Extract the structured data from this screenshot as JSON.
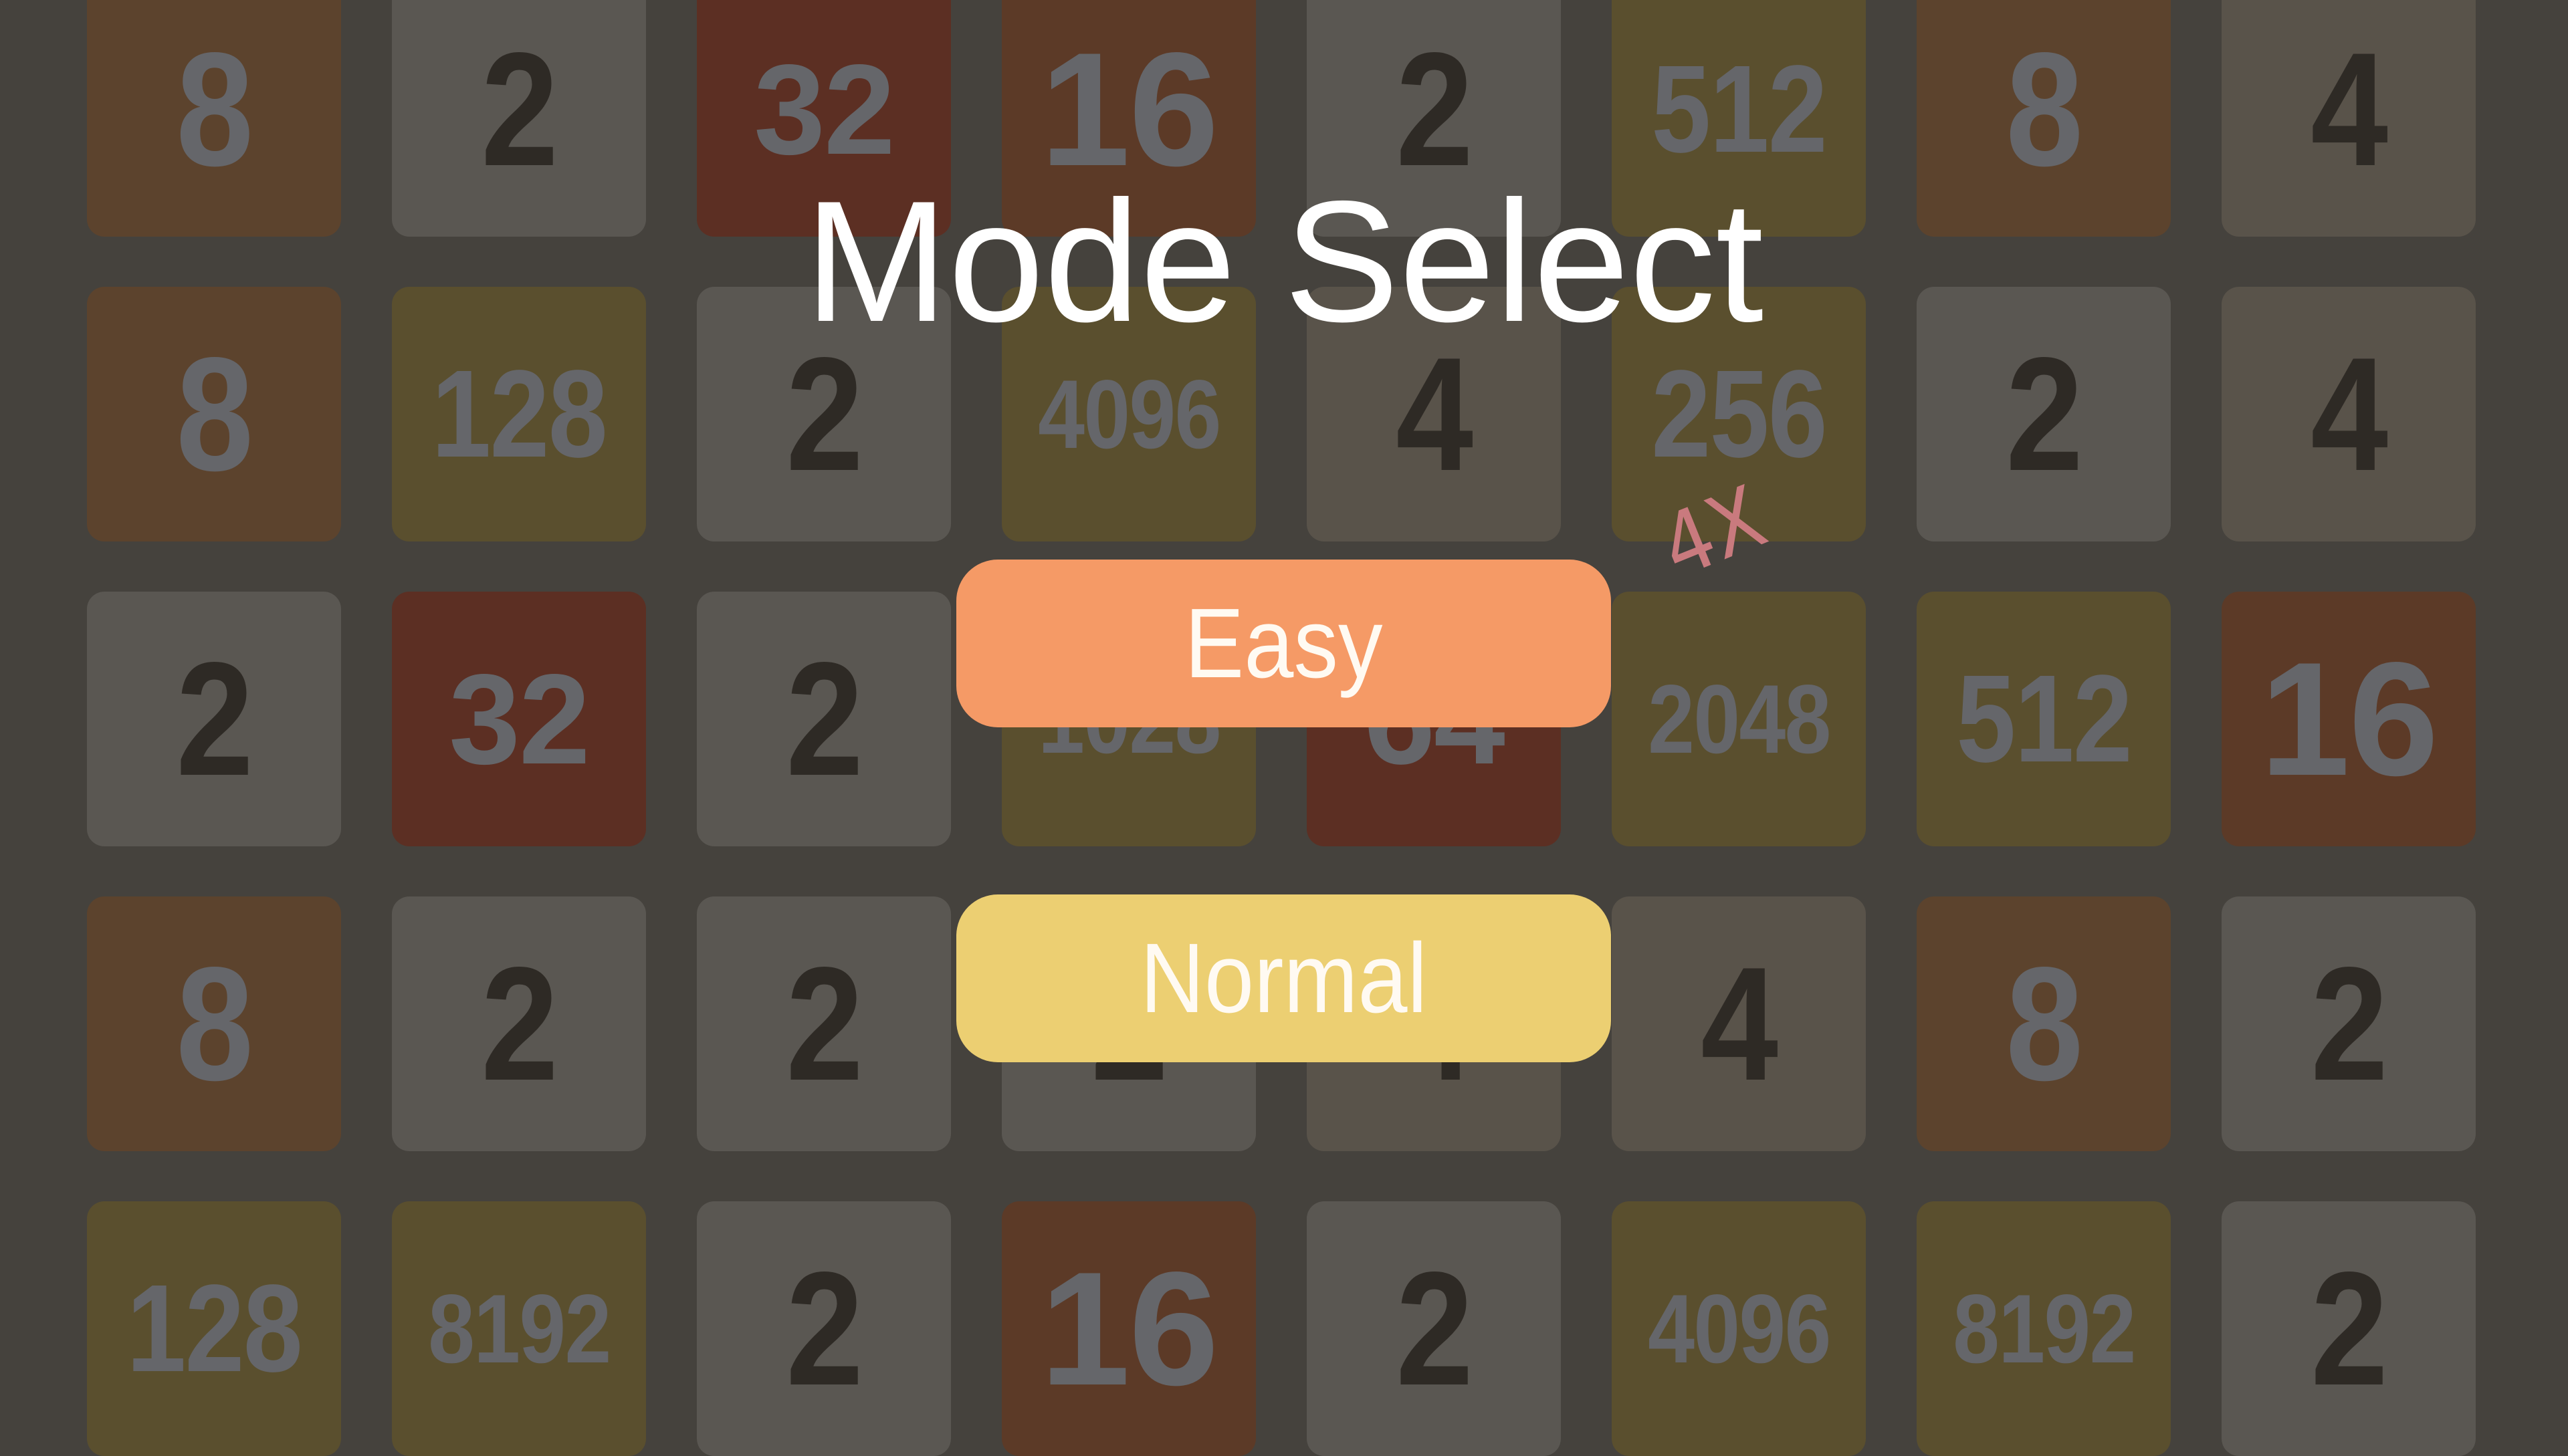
{
  "screen": {
    "title": "Mode Select",
    "multiplier_label": "4X",
    "buttons": [
      {
        "id": "easy",
        "label": "Easy",
        "color": "#f59a66"
      },
      {
        "id": "normal",
        "label": "Normal",
        "color": "#eccf72"
      }
    ]
  },
  "board": {
    "rows": [
      [
        "8",
        "2",
        "32",
        "16",
        "2",
        "512",
        "8",
        "4"
      ],
      [
        "8",
        "128",
        "2",
        "4096",
        "4",
        "256",
        "2",
        "4"
      ],
      [
        "2",
        "32",
        "2",
        "1028",
        "64",
        "2048",
        "512",
        "16"
      ],
      [
        "8",
        "2",
        "2",
        "2",
        "4",
        "4",
        "8",
        "2"
      ],
      [
        "128",
        "8192",
        "2",
        "16",
        "2",
        "4096",
        "8192",
        "2"
      ]
    ]
  },
  "colors": {
    "background": "#45423d",
    "tile_2": "#5a5752",
    "tile_4": "#59534a",
    "tile_8": "#5c432d",
    "tile_16": "#5c3a27",
    "tile_32": "#5c2f23",
    "tile_64": "#5c2f23",
    "tile_high": "#5a4f2e",
    "text_dark": "#2e2a25",
    "text_light": "#65666a",
    "multiplier": "#c97a7e"
  }
}
